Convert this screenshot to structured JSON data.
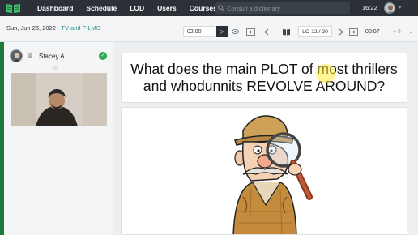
{
  "nav": {
    "logo_icon": "book-logo-icon",
    "items": [
      "Dashboard",
      "Schedule",
      "LOD",
      "Users",
      "Courses"
    ],
    "search_placeholder": "Consult a dictionary",
    "time": "16:22"
  },
  "toolbar": {
    "date": "Sun, Jun 26, 2022",
    "separator": " - ",
    "category": "TV and FILMS",
    "timer_value": "02:00",
    "lesson": "LO 12 / 20",
    "duration": "00:07",
    "plus": "+ 5"
  },
  "participant": {
    "name": "Stacey A",
    "status_color": "#2eaa4e"
  },
  "slide": {
    "question": "What does the main PLOT of most thrillers and whodunnits REVOLVE AROUND?",
    "image_subject": "cartoon detective with magnifying glass"
  },
  "colors": {
    "topbar": "#2b3137",
    "accent_green": "#1d7a3c",
    "category_teal": "#2a8c8c",
    "highlight": "#ffec3c"
  }
}
